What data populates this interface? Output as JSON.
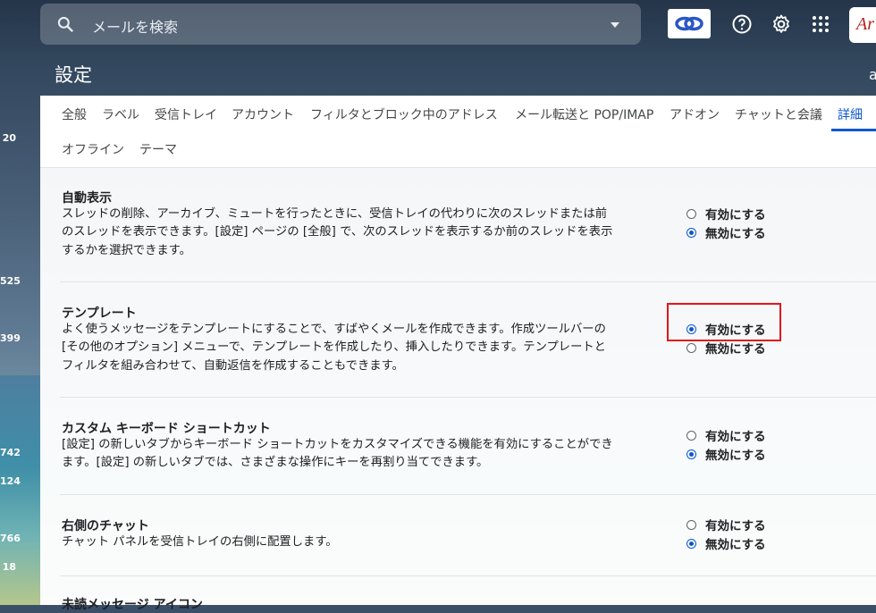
{
  "search": {
    "placeholder": "メールを検索"
  },
  "account": {
    "logo_text": "Ar"
  },
  "header": {
    "title": "設定",
    "edge_char": "a"
  },
  "left_counts": [
    "20",
    "525",
    "399",
    "742",
    "124",
    "766",
    "18"
  ],
  "tabs": [
    {
      "label": "全般"
    },
    {
      "label": "ラベル"
    },
    {
      "label": "受信トレイ"
    },
    {
      "label": "アカウント"
    },
    {
      "label": "フィルタとブロック中のアドレス"
    },
    {
      "label": "メール転送と POP/IMAP"
    },
    {
      "label": "アドオン"
    },
    {
      "label": "チャットと会議"
    },
    {
      "label": "詳細"
    },
    {
      "label": "オフライン"
    },
    {
      "label": "テーマ"
    }
  ],
  "settings": [
    {
      "title": "自動表示",
      "description": "スレッドの削除、アーカイブ、ミュートを行ったときに、受信トレイの代わりに次のスレッドまたは前のスレッドを表示できます。[設定] ページの [全般] で、次のスレッドを表示するか前のスレッドを表示するかを選択できます。",
      "enable_label": "有効にする",
      "disable_label": "無効にする",
      "selected": "disable"
    },
    {
      "title": "テンプレート",
      "description": "よく使うメッセージをテンプレートにすることで、すばやくメールを作成できます。作成ツールバーの [その他のオプション] メニューで、テンプレートを作成したり、挿入したりできます。テンプレートとフィルタを組み合わせて、自動返信を作成することもできます。",
      "enable_label": "有効にする",
      "disable_label": "無効にする",
      "selected": "enable"
    },
    {
      "title": "カスタム キーボード ショートカット",
      "description": "[設定] の新しいタブからキーボード ショートカットをカスタマイズできる機能を有効にすることができます。[設定] の新しいタブでは、さまざまな操作にキーを再割り当てできます。",
      "enable_label": "有効にする",
      "disable_label": "無効にする",
      "selected": "disable"
    },
    {
      "title": "右側のチャット",
      "description": "チャット パネルを受信トレイの右側に配置します。",
      "enable_label": "有効にする",
      "disable_label": "無効にする",
      "selected": "disable"
    }
  ],
  "next_section_title": "未読メッセージ アイコン",
  "colors": {
    "accent": "#0b57d0",
    "highlight": "#e0161b"
  }
}
